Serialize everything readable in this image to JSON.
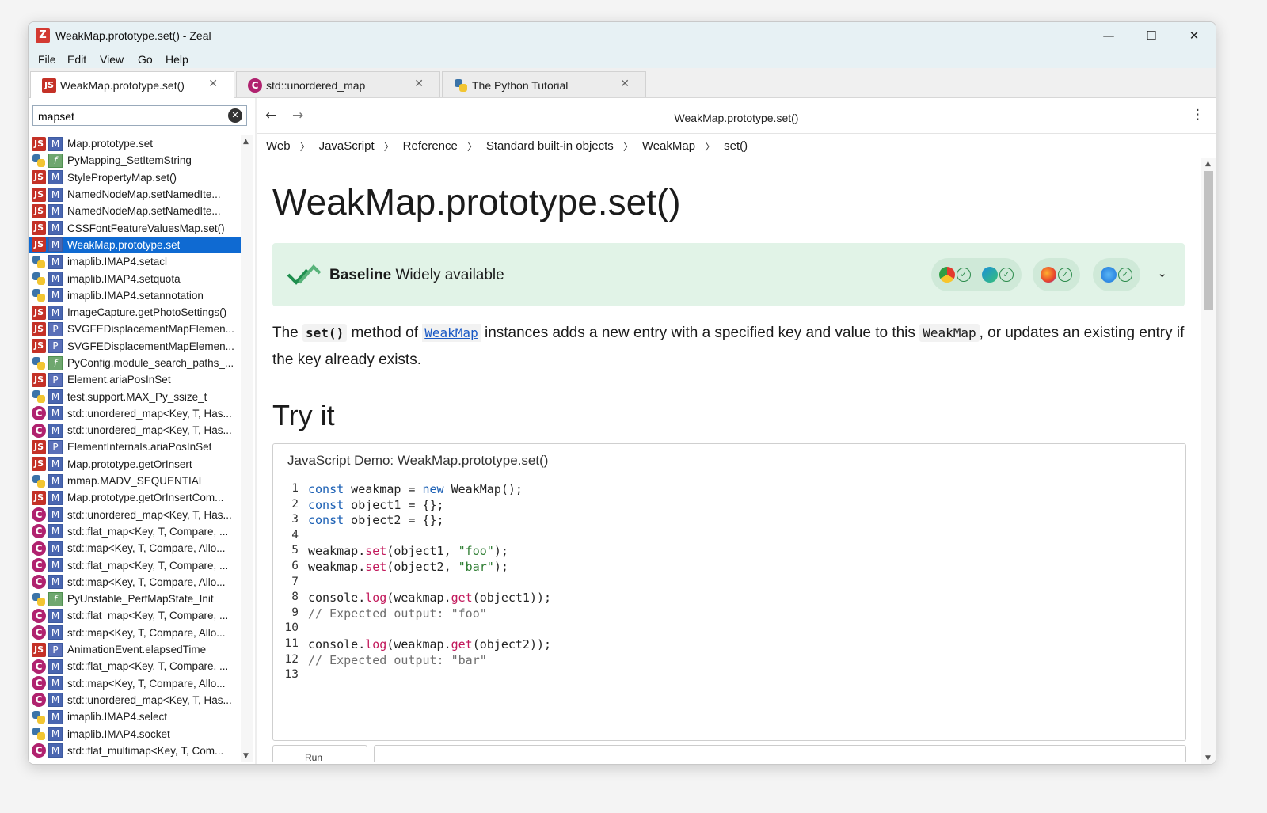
{
  "window": {
    "title": "WeakMap.prototype.set() - Zeal",
    "logo": "Z"
  },
  "menu": [
    "File",
    "Edit",
    "View",
    "Go",
    "Help"
  ],
  "tabs": [
    {
      "label": "WeakMap.prototype.set()",
      "icon": "js-icon",
      "active": true
    },
    {
      "label": "std::unordered_map",
      "icon": "cpp-icon",
      "active": false
    },
    {
      "label": "The Python Tutorial",
      "icon": "python-icon",
      "active": false
    }
  ],
  "search": {
    "value": "mapset",
    "placeholder": ""
  },
  "results": [
    {
      "icon": "js",
      "type": "M",
      "name": "Map.prototype.set"
    },
    {
      "icon": "py",
      "type": "f",
      "name": "PyMapping_SetItemString"
    },
    {
      "icon": "js",
      "type": "M",
      "name": "StylePropertyMap.set()"
    },
    {
      "icon": "js",
      "type": "M",
      "name": "NamedNodeMap.setNamedIte..."
    },
    {
      "icon": "js",
      "type": "M",
      "name": "NamedNodeMap.setNamedIte..."
    },
    {
      "icon": "js",
      "type": "M",
      "name": "CSSFontFeatureValuesMap.set()"
    },
    {
      "icon": "js",
      "type": "M",
      "name": "WeakMap.prototype.set",
      "selected": true
    },
    {
      "icon": "py",
      "type": "M",
      "name": "imaplib.IMAP4.setacl"
    },
    {
      "icon": "py",
      "type": "M",
      "name": "imaplib.IMAP4.setquota"
    },
    {
      "icon": "py",
      "type": "M",
      "name": "imaplib.IMAP4.setannotation"
    },
    {
      "icon": "js",
      "type": "M",
      "name": "ImageCapture.getPhotoSettings()"
    },
    {
      "icon": "js",
      "type": "P",
      "name": "SVGFEDisplacementMapElemen..."
    },
    {
      "icon": "js",
      "type": "P",
      "name": "SVGFEDisplacementMapElemen..."
    },
    {
      "icon": "py",
      "type": "f",
      "name": "PyConfig.module_search_paths_..."
    },
    {
      "icon": "js",
      "type": "P",
      "name": "Element.ariaPosInSet"
    },
    {
      "icon": "py",
      "type": "M",
      "name": "test.support.MAX_Py_ssize_t"
    },
    {
      "icon": "cpp",
      "type": "M",
      "name": "std::unordered_map<Key, T, Has..."
    },
    {
      "icon": "cpp",
      "type": "M",
      "name": "std::unordered_map<Key, T, Has..."
    },
    {
      "icon": "js",
      "type": "P",
      "name": "ElementInternals.ariaPosInSet"
    },
    {
      "icon": "js",
      "type": "M",
      "name": "Map.prototype.getOrInsert"
    },
    {
      "icon": "py",
      "type": "M",
      "name": "mmap.MADV_SEQUENTIAL"
    },
    {
      "icon": "js",
      "type": "M",
      "name": "Map.prototype.getOrInsertCom..."
    },
    {
      "icon": "cpp",
      "type": "M",
      "name": "std::unordered_map<Key, T, Has..."
    },
    {
      "icon": "cpp",
      "type": "M",
      "name": "std::flat_map<Key, T, Compare, ..."
    },
    {
      "icon": "cpp",
      "type": "M",
      "name": "std::map<Key, T, Compare, Allo..."
    },
    {
      "icon": "cpp",
      "type": "M",
      "name": "std::flat_map<Key, T, Compare, ..."
    },
    {
      "icon": "cpp",
      "type": "M",
      "name": "std::map<Key, T, Compare, Allo..."
    },
    {
      "icon": "py",
      "type": "f",
      "name": "PyUnstable_PerfMapState_Init"
    },
    {
      "icon": "cpp",
      "type": "M",
      "name": "std::flat_map<Key, T, Compare, ..."
    },
    {
      "icon": "cpp",
      "type": "M",
      "name": "std::map<Key, T, Compare, Allo..."
    },
    {
      "icon": "js",
      "type": "P",
      "name": "AnimationEvent.elapsedTime"
    },
    {
      "icon": "cpp",
      "type": "M",
      "name": "std::flat_map<Key, T, Compare, ..."
    },
    {
      "icon": "cpp",
      "type": "M",
      "name": "std::map<Key, T, Compare, Allo..."
    },
    {
      "icon": "cpp",
      "type": "M",
      "name": "std::unordered_map<Key, T, Has..."
    },
    {
      "icon": "py",
      "type": "M",
      "name": "imaplib.IMAP4.select"
    },
    {
      "icon": "py",
      "type": "M",
      "name": "imaplib.IMAP4.socket"
    },
    {
      "icon": "cpp",
      "type": "M",
      "name": "std::flat_multimap<Key, T, Com..."
    }
  ],
  "nav": {
    "page_title": "WeakMap.prototype.set()"
  },
  "breadcrumb": [
    "Web",
    "JavaScript",
    "Reference",
    "Standard built-in objects",
    "WeakMap",
    "set()"
  ],
  "doc": {
    "title": "WeakMap.prototype.set()",
    "baseline_strong": "Baseline",
    "baseline_text": "Widely available",
    "para_1": "The ",
    "para_code_1": "set()",
    "para_2": " method of ",
    "para_link": "WeakMap",
    "para_3": " instances adds a new entry with a specified key and value to this ",
    "para_code_2": "WeakMap",
    "para_4": ", or updates an existing entry if the key already exists.",
    "section_title": "Try it",
    "demo_title": "JavaScript Demo: WeakMap.prototype.set()",
    "run_label": "Run"
  },
  "colors": {
    "accent": "#0f6ad2",
    "baseline_bg": "#e1f3e7",
    "titlebar": "#e7f1f4"
  }
}
